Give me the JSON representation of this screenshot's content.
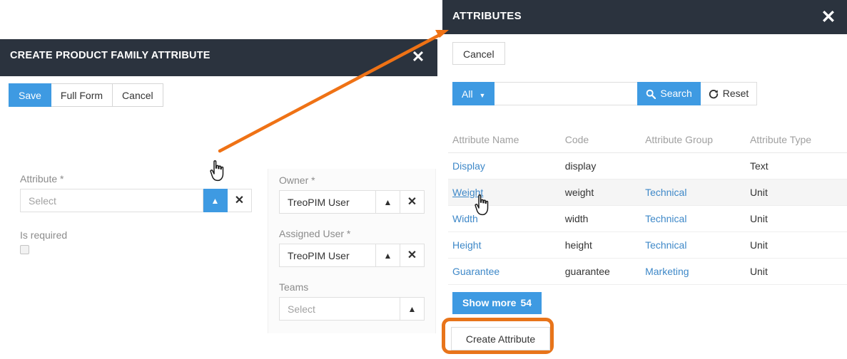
{
  "left_modal": {
    "title": "CREATE PRODUCT FAMILY ATTRIBUTE",
    "close_icon": "close-icon",
    "buttons": {
      "save": "Save",
      "full_form": "Full Form",
      "cancel": "Cancel"
    },
    "fields": {
      "attribute": {
        "label": "Attribute *",
        "value": "",
        "placeholder": "Select",
        "chevron_icon": "chevron-up-icon",
        "clear_icon": "close-icon"
      },
      "is_required": {
        "label": "Is required",
        "checked": false
      },
      "owner": {
        "label": "Owner *",
        "value": "TreoPIM User",
        "chevron_icon": "chevron-up-icon",
        "clear_icon": "close-icon"
      },
      "assigned_user": {
        "label": "Assigned User *",
        "value": "TreoPIM User",
        "chevron_icon": "chevron-up-icon",
        "clear_icon": "close-icon"
      },
      "teams": {
        "label": "Teams",
        "value": "",
        "placeholder": "Select",
        "chevron_icon": "chevron-up-icon"
      }
    }
  },
  "right_panel": {
    "title": "ATTRIBUTES",
    "close_icon": "close-icon",
    "cancel_label": "Cancel",
    "search": {
      "scope_label": "All",
      "scope_caret_icon": "caret-down-icon",
      "value": "",
      "placeholder": "",
      "search_label": "Search",
      "search_icon": "magnifier-icon",
      "reset_label": "Reset",
      "reset_icon": "refresh-icon"
    },
    "table": {
      "columns": [
        "Attribute Name",
        "Code",
        "Attribute Group",
        "Attribute Type"
      ],
      "rows": [
        {
          "name": "Display",
          "code": "display",
          "group": "",
          "type": "Text"
        },
        {
          "name": "Weight",
          "code": "weight",
          "group": "Technical",
          "type": "Unit"
        },
        {
          "name": "Width",
          "code": "width",
          "group": "Technical",
          "type": "Unit"
        },
        {
          "name": "Height",
          "code": "height",
          "group": "Technical",
          "type": "Unit"
        },
        {
          "name": "Guarantee",
          "code": "guarantee",
          "group": "Marketing",
          "type": "Unit"
        }
      ]
    },
    "show_more": {
      "label": "Show more",
      "count": "54"
    },
    "create_attribute_label": "Create Attribute"
  },
  "annotation": {
    "arrow_color": "#ef7215",
    "highlight_color": "#e8741a",
    "arrow_from": "attribute-select-chevron",
    "arrow_to": "attributes-panel-header"
  },
  "colors": {
    "header_dark": "#2b333e",
    "primary_blue": "#3e9ae2",
    "link_blue": "#3e88c8",
    "orange": "#e8741a"
  }
}
